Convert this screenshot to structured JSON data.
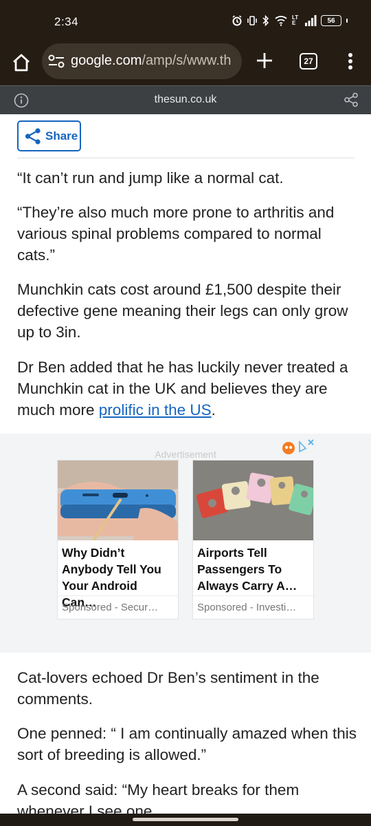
{
  "status_bar": {
    "time": "2:34",
    "battery": "56",
    "network": "LTE"
  },
  "browser": {
    "url_host": "google.com",
    "url_path": "/amp/s/www.th",
    "tab_count": "27"
  },
  "amp_header": {
    "domain": "thesun.co.uk"
  },
  "article": {
    "share_label": "Share",
    "paragraphs": [
      "“It can’t run and jump like a normal cat.",
      "“They’re also much more prone to arthritis and various spinal problems compared to normal cats.”",
      "Munchkin cats cost around £1,500 despite their defective gene meaning their legs can only grow up to 3in."
    ],
    "para4_text": "Dr Ben added that he has luckily never treated a Munchkin cat in the UK and believes they are much more ",
    "para4_link": "prolific in the US",
    "para4_end": ".",
    "paragraphs_after": [
      "Cat-lovers echoed Dr Ben’s sentiment in the comments.",
      "One penned: “ I am continually amazed when this sort of breeding is allowed.”",
      "A second said: “My heart breaks for them whenever I see one."
    ]
  },
  "ad": {
    "label": "Advertisement",
    "cards": [
      {
        "title": "Why Didn’t Anybody Tell You Your Android Can…",
        "sponsor": "Sponsored - Secur…"
      },
      {
        "title": "Airports Tell Passengers To Always Carry A…",
        "sponsor": "Sponsored - Investi…"
      }
    ]
  },
  "colors": {
    "link": "#1565c0",
    "chrome_bg": "#251d14",
    "amp_bar": "#3c4043"
  }
}
